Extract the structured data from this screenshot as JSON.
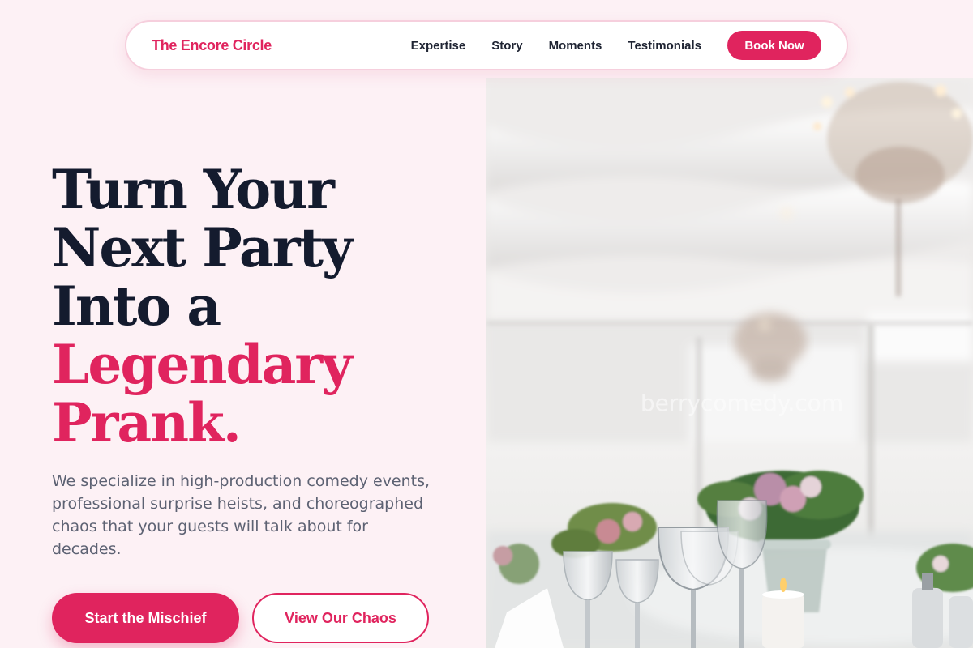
{
  "nav": {
    "brand": "The Encore Circle",
    "links": [
      "Expertise",
      "Story",
      "Moments",
      "Testimonials"
    ],
    "cta": "Book Now"
  },
  "hero": {
    "headline_lines": [
      "Turn Your",
      "Next Party",
      "Into a"
    ],
    "headline_accent_lines": [
      "Legendary",
      "Prank."
    ],
    "subcopy": "We specialize in high-production comedy events, professional surprise heists, and choreographed chaos that your guests will talk about for decades.",
    "primary_cta": "Start the Mischief",
    "secondary_cta": "View Our Chaos",
    "image_watermark": "berrycomedy.com"
  },
  "colors": {
    "accent": "#e0245e",
    "page_background": "#fdf1f5",
    "headline": "#141b2e",
    "body_text": "#5d6273"
  }
}
